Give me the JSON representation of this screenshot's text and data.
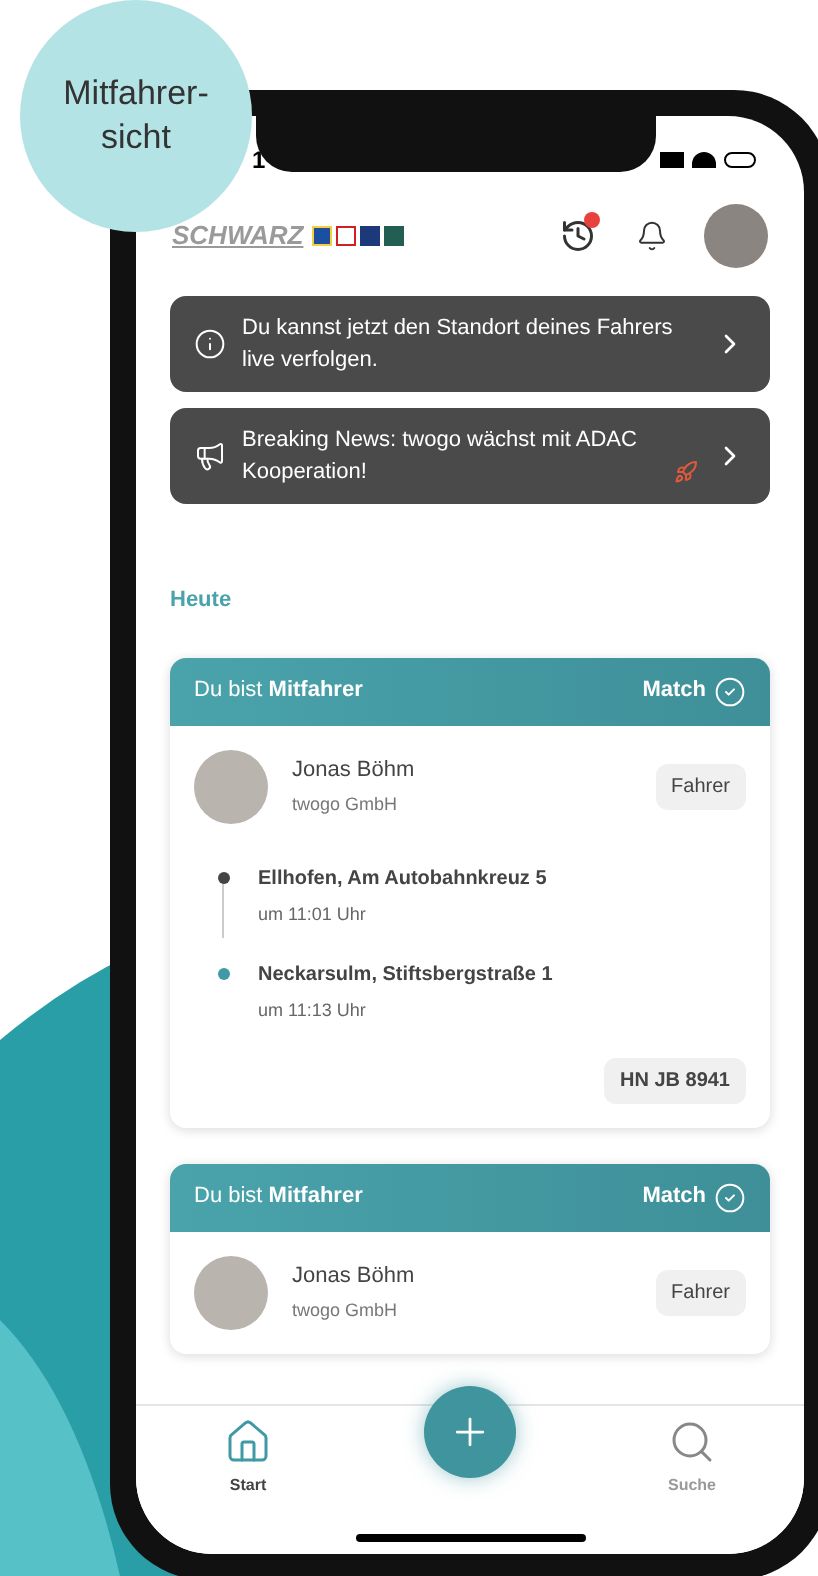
{
  "badge": {
    "lines": [
      "Mitfahrer-",
      "sicht"
    ]
  },
  "status_bar": {
    "time": "1"
  },
  "header": {
    "logo_text": "SCHWARZ",
    "history_has_notification": true
  },
  "notices": [
    {
      "kind": "info",
      "text": "Du kannst jetzt den Standort deines Fahrers live verfolgen."
    },
    {
      "kind": "news",
      "text": "Breaking News: twogo wächst mit ADAC Kooperation!",
      "rocket": true
    }
  ],
  "section_title": "Heute",
  "rides": [
    {
      "role_text": "Du bist **Mitfahrer**",
      "status": "Match",
      "name": "Jonas Böhm",
      "company": "twogo GmbH",
      "role_badge": "Fahrer",
      "stops": [
        {
          "kind": "start",
          "place": "Ellhofen, Am Autobahnkreuz 5",
          "time": "um 11:01 Uhr"
        },
        {
          "kind": "end",
          "place": "Neckarsulm, Stiftsbergstraße 1",
          "time": "um 11:13 Uhr"
        }
      ],
      "plate": "HN JB 8941"
    },
    {
      "role_text": "Du bist **Mitfahrer**",
      "status": "Match",
      "name": "Jonas Böhm",
      "company": "twogo GmbH",
      "role_badge": "Fahrer"
    }
  ],
  "nav": [
    {
      "kind": "home",
      "label": "Start",
      "selected": true
    },
    {
      "kind": "search",
      "label": "Suche",
      "selected": false
    }
  ]
}
